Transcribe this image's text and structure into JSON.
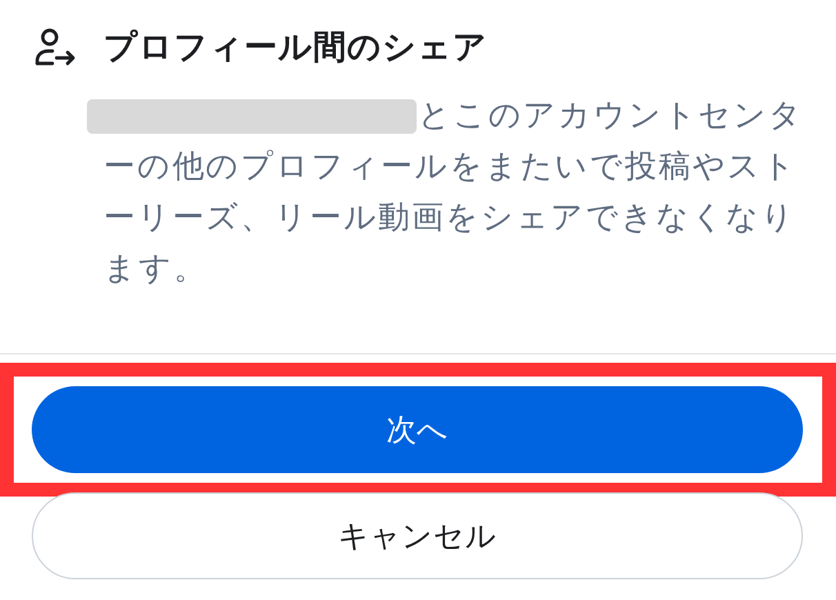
{
  "section": {
    "title": "プロフィール間のシェア",
    "redacted_prefix": true,
    "description": "とこのアカウントセンターの他のプロフィールをまたいで投稿やストーリーズ、リール動画をシェアできなくなります。"
  },
  "buttons": [
    {
      "label": "次へ",
      "kind": "primary",
      "highlighted": true
    },
    {
      "label": "キャンセル",
      "kind": "secondary",
      "highlighted": false
    }
  ]
}
